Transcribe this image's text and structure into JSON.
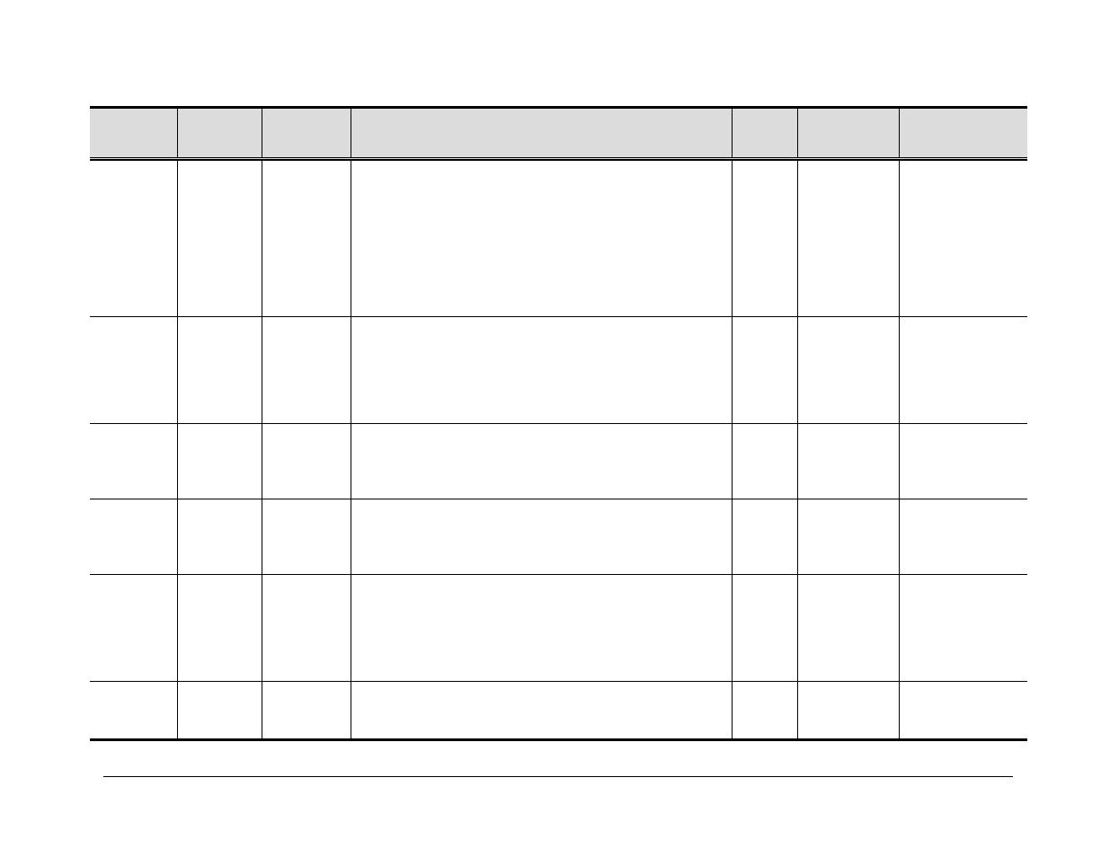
{
  "table": {
    "headers": [
      "",
      "",
      "",
      "",
      "",
      "",
      ""
    ],
    "rows": [
      [
        "",
        "",
        "",
        "",
        "",
        "",
        ""
      ],
      [
        "",
        "",
        "",
        "",
        "",
        "",
        ""
      ],
      [
        "",
        "",
        "",
        "",
        "",
        "",
        ""
      ],
      [
        "",
        "",
        "",
        "",
        "",
        "",
        ""
      ],
      [
        "",
        "",
        "",
        "",
        "",
        "",
        ""
      ],
      [
        "",
        "",
        "",
        "",
        "",
        "",
        ""
      ]
    ]
  }
}
